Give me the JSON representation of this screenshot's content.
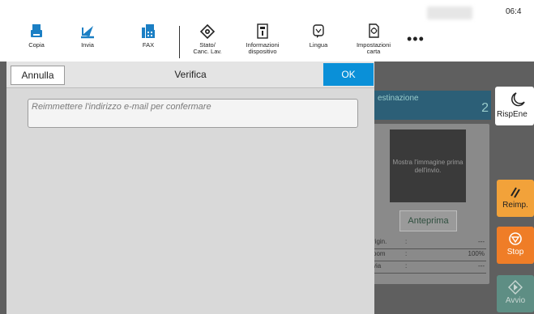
{
  "status": {
    "clock": "06:4"
  },
  "nav": {
    "items": [
      {
        "label": "Copia",
        "icon": "copy-icon"
      },
      {
        "label": "Invia",
        "icon": "send-icon"
      },
      {
        "label": "FAX",
        "icon": "fax-icon"
      },
      {
        "label": "Stato/\nCanc. Lav.",
        "icon": "status-icon"
      },
      {
        "label": "Informazioni\ndispositivo",
        "icon": "info-icon"
      },
      {
        "label": "Lingua",
        "icon": "language-icon"
      },
      {
        "label": "Impostazioni\ncarta",
        "icon": "paper-settings-icon"
      }
    ],
    "more": "•••"
  },
  "background": {
    "destination_label": "estinazione",
    "destination_count": "2",
    "preview_text": "Mostra l'immagine prima dell'invio.",
    "preview_button": "Anteprima",
    "info_rows": [
      {
        "key": "rigin.",
        "sep": ":",
        "value": "---"
      },
      {
        "key": "oom",
        "sep": ":",
        "value": "100%"
      },
      {
        "key": "via",
        "sep": ":",
        "value": "---"
      }
    ]
  },
  "side": {
    "energy_label": "RispEne",
    "reset_label": "Reimp.",
    "stop_label": "Stop",
    "start_label": "Avvio"
  },
  "dialog": {
    "cancel_label": "Annulla",
    "title": "Verifica",
    "ok_label": "OK",
    "input_placeholder": "Reimmettere l'indirizzo e-mail per confermare",
    "input_value": ""
  },
  "colors": {
    "accent": "#0a90d8",
    "stop": "#ef7d27",
    "reset": "#f2a23a",
    "start": "#5e8e84"
  }
}
